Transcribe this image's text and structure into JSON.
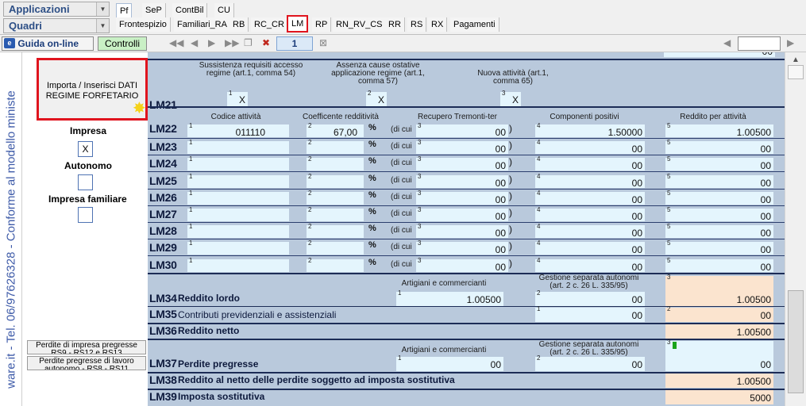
{
  "toolbar": {
    "apps_label": "Applicazioni",
    "quadri_label": "Quadri",
    "tabs_top": [
      "Pf",
      "SeP",
      "ContBil",
      "CU"
    ],
    "tabs_bottom": [
      "Frontespizio",
      "Familiari_RA",
      "RB",
      "RC_CR",
      "LM",
      "RP",
      "RN_RV_CS",
      "RR",
      "RS",
      "RX",
      "Pagamenti"
    ]
  },
  "nav": {
    "guida_label": "Guida on-line",
    "controlli_label": "Controlli",
    "page_number": "1"
  },
  "left": {
    "vertical_text": "ware.it - Tel. 06/97626328 - Conforme al modello ministe",
    "import_button": "Importa / Inserisci DATI REGIME FORFETARIO",
    "impresa_label": "Impresa",
    "impresa_value": "X",
    "autonomo_label": "Autonomo",
    "impresa_fam_label": "Impresa familiare",
    "perdite_impresa_button": "Perdite di impresa pregresse RS9 - RS12 e RS13",
    "perdite_lavoro_button": "Perdite pregresse di lavoro autonomo - RS8 - RS11"
  },
  "lm21": {
    "code": "LM21",
    "h1": "Sussistenza requisiti accesso regime (art.1, comma 54)",
    "h2": "Assenza cause ostative applicazione regime (art.1, comma 57)",
    "h3": "Nuova attività (art.1, comma 65)",
    "v1": "X",
    "v2": "X",
    "v3": "X"
  },
  "lm22_headers": {
    "codice": "Codice attività",
    "coeff": "Coefficente redditività",
    "recupero": "Recupero Tremonti-ter",
    "componenti": "Componenti positivi",
    "reddito": "Reddito per attività",
    "dicui": "(di cui",
    "pct": "%",
    "paren": ")"
  },
  "rows": [
    {
      "code": "LM22",
      "codice": "011110",
      "coeff": "67,00",
      "rec": "00",
      "comp": "1.500",
      "red": "1.005"
    },
    {
      "code": "LM23",
      "codice": "",
      "coeff": "",
      "rec": "00",
      "comp": "00",
      "red": "00"
    },
    {
      "code": "LM24",
      "codice": "",
      "coeff": "",
      "rec": "00",
      "comp": "00",
      "red": "00"
    },
    {
      "code": "LM25",
      "codice": "",
      "coeff": "",
      "rec": "00",
      "comp": "00",
      "red": "00"
    },
    {
      "code": "LM26",
      "codice": "",
      "coeff": "",
      "rec": "00",
      "comp": "00",
      "red": "00"
    },
    {
      "code": "LM27",
      "codice": "",
      "coeff": "",
      "rec": "00",
      "comp": "00",
      "red": "00"
    },
    {
      "code": "LM28",
      "codice": "",
      "coeff": "",
      "rec": "00",
      "comp": "00",
      "red": "00"
    },
    {
      "code": "LM29",
      "codice": "",
      "coeff": "",
      "rec": "00",
      "comp": "00",
      "red": "00"
    },
    {
      "code": "LM30",
      "codice": "",
      "coeff": "",
      "rec": "00",
      "comp": "00",
      "red": "00"
    }
  ],
  "suffix00": "00",
  "lm34": {
    "code": "LM34",
    "label": "Reddito lordo",
    "h_art": "Artigiani e commercianti",
    "h_gest": "Gestione separata autonomi (art. 2 c. 26 L. 335/95)",
    "v1": "1.005",
    "v2": "00",
    "v3": "1.005"
  },
  "lm35": {
    "code": "LM35",
    "label": "Contributi previdenziali e assistenziali",
    "v1": "00",
    "v2": "00"
  },
  "lm36": {
    "code": "LM36",
    "label": "Reddito netto",
    "v1": "1.005"
  },
  "lm37": {
    "code": "LM37",
    "label": "Perdite pregresse",
    "h_art": "Artigiani e commercianti",
    "h_gest": "Gestione separata autonomi (art. 2 c. 26 L. 335/95)",
    "v1": "00",
    "v2": "00",
    "v3": "00"
  },
  "lm38": {
    "code": "LM38",
    "label": "Reddito al netto delle perdite soggetto ad imposta sostitutiva",
    "v1": "1.005"
  },
  "lm39": {
    "code": "LM39",
    "label": "Imposta sostitutiva",
    "v1": "50"
  },
  "top_partial": "00"
}
